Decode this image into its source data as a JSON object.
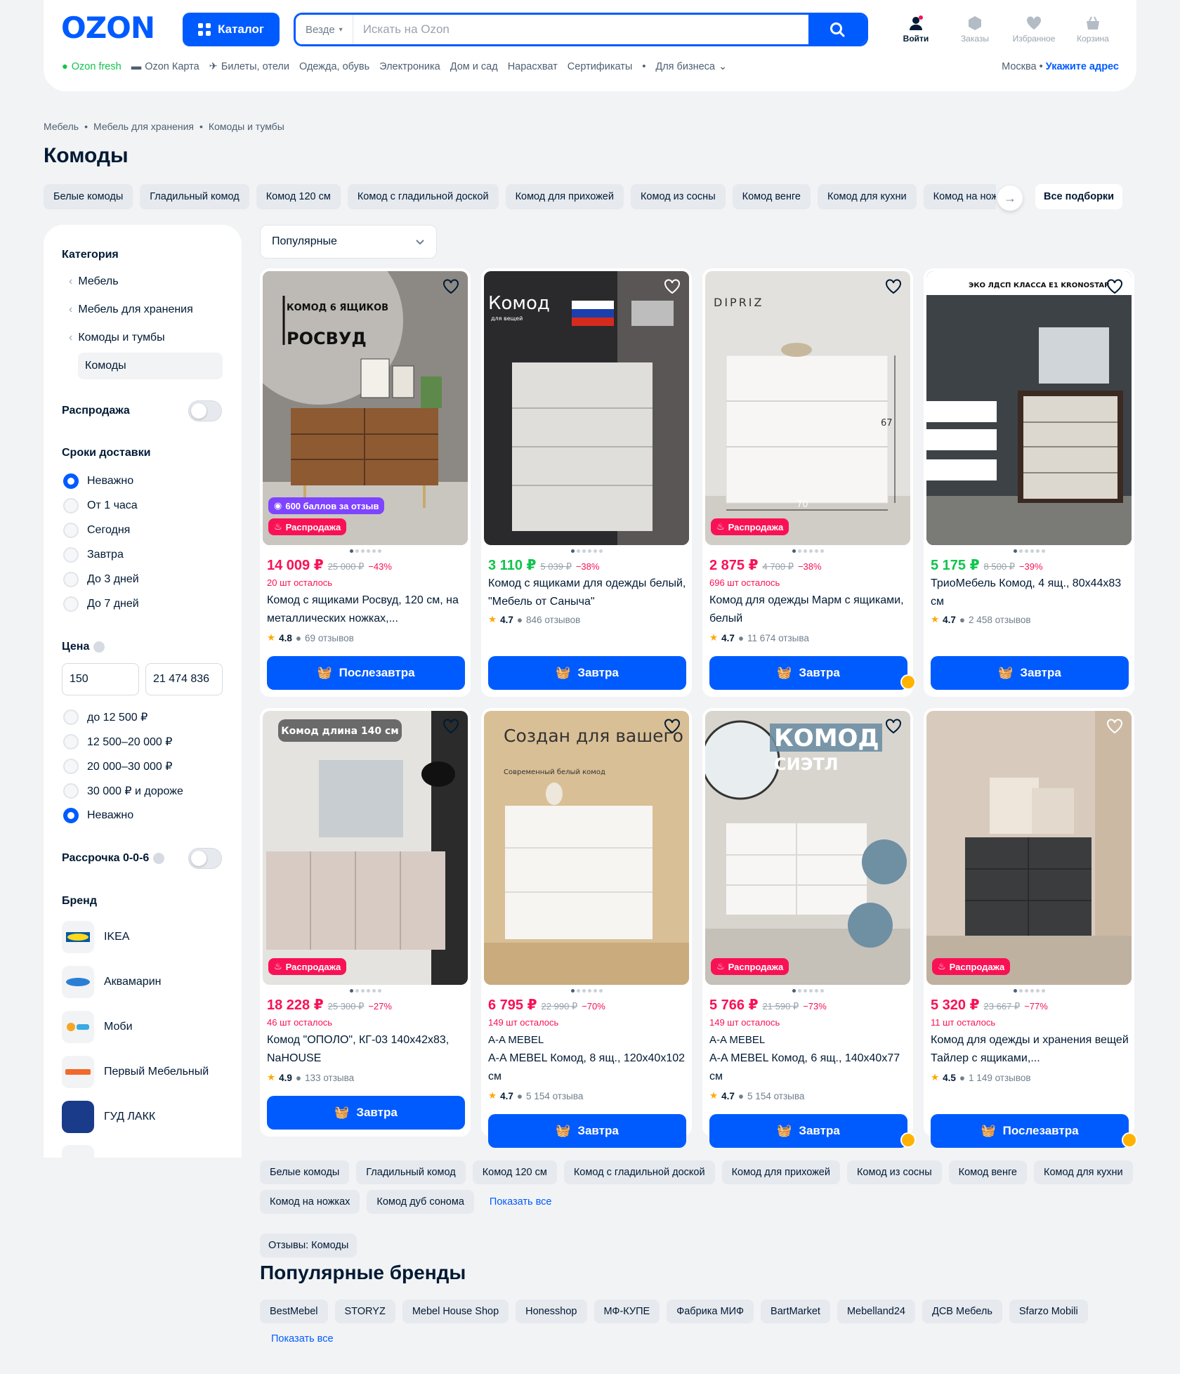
{
  "header": {
    "catalog_label": "Каталог",
    "search_scope": "Везде",
    "search_placeholder": "Искать на Ozon",
    "actions": [
      "Войти",
      "Заказы",
      "Избранное",
      "Корзина"
    ],
    "nav": [
      "Ozon fresh",
      "Ozon Карта",
      "Билеты, отели",
      "Одежда, обувь",
      "Электроника",
      "Дом и сад",
      "Нарасхват",
      "Сертификаты",
      "Для бизнеса"
    ],
    "city": "Москва",
    "address_link": "Укажите адрес"
  },
  "breadcrumb": [
    "Мебель",
    "Мебель для хранения",
    "Комоды и тумбы"
  ],
  "page_title": "Комоды",
  "chips": [
    "Белые комоды",
    "Гладильный комод",
    "Комод 120 см",
    "Комод с гладильной доской",
    "Комод для прихожей",
    "Комод из сосны",
    "Комод венге",
    "Комод для кухни",
    "Комод на ножках"
  ],
  "chips_all": "Все подборки",
  "sidebar": {
    "category_title": "Категория",
    "categories": [
      "Мебель",
      "Мебель для хранения",
      "Комоды и тумбы"
    ],
    "current_category": "Комоды",
    "sale_label": "Распродажа",
    "delivery_title": "Сроки доставки",
    "delivery_options": [
      "Неважно",
      "От 1 часа",
      "Сегодня",
      "Завтра",
      "До 3 дней",
      "До 7 дней"
    ],
    "price_title": "Цена",
    "price_from": "150",
    "price_to": "21 474 836",
    "price_options": [
      "до 12 500 ₽",
      "12 500–20 000 ₽",
      "20 000–30 000 ₽",
      "30 000 ₽ и дороже",
      "Неважно"
    ],
    "installment_label": "Рассрочка 0-0-6",
    "brand_title": "Бренд",
    "brands": [
      "IKEA",
      "Аквамарин",
      "Моби",
      "Первый Мебельный",
      "ГУД ЛАКК"
    ]
  },
  "sort_label": "Популярные",
  "products": [
    {
      "price": "14 009 ₽",
      "old": "25 000 ₽",
      "disc": "−43%",
      "left": "20 шт осталось",
      "title": "Комод с ящиками Росвуд, 120 см, на металлических ножках,...",
      "rating": "4.8",
      "reviews": "69 отзывов",
      "button": "Послезавтра",
      "img_text": "КОМОД 6 ЯЩИКОВ",
      "img_text2": "РОСВУД",
      "bonus": "600 баллов за отзыв",
      "sale": "Распродажа"
    },
    {
      "price": "3 110 ₽",
      "old": "5 039 ₽",
      "disc": "−38%",
      "title": "Комод с ящиками для одежды белый, \"Мебель от Саныча\"",
      "rating": "4.7",
      "reviews": "846 отзывов",
      "button": "Завтра",
      "img_text": "Комод",
      "img_text2": "для вещей"
    },
    {
      "price": "2 875 ₽",
      "old": "4 700 ₽",
      "disc": "−38%",
      "left": "696 шт осталось",
      "title": "Комод для одежды Марм с ящиками, белый",
      "rating": "4.7",
      "reviews": "11 674 отзыва",
      "button": "Завтра",
      "img_text": "DIPRIZ",
      "sale": "Распродажа"
    },
    {
      "price": "5 175 ₽",
      "old": "8 500 ₽",
      "disc": "−39%",
      "title": "ТриоМебель Комод, 4 ящ., 80х44х83 см",
      "rating": "4.7",
      "reviews": "2 458 отзывов",
      "button": "Завтра",
      "img_text": "ЭКО ЛДСП КЛАССА Е1 KRONOSTAR"
    },
    {
      "price": "18 228 ₽",
      "old": "25 300 ₽",
      "disc": "−27%",
      "left": "46 шт осталось",
      "title": "Комод \"ОПОЛО\", КГ-03 140х42х83, NaHOUSE",
      "rating": "4.9",
      "reviews": "133 отзыва",
      "button": "Завтра",
      "img_text": "Комод длина 140 см",
      "sale": "Распродажа"
    },
    {
      "price": "6 795 ₽",
      "old": "22 990 ₽",
      "disc": "−70%",
      "left": "149 шт осталось",
      "brand": "A-A MEBEL",
      "title": "A-A MEBEL Комод, 8 ящ., 120х40х102 см",
      "rating": "4.7",
      "reviews": "5 154 отзыва",
      "button": "Завтра",
      "img_text": "Создан для вашего уюта",
      "img_text2": "Современный белый комод"
    },
    {
      "price": "5 766 ₽",
      "old": "21 590 ₽",
      "disc": "−73%",
      "left": "149 шт осталось",
      "brand": "A-A MEBEL",
      "title": "A-A MEBEL Комод, 6 ящ., 140х40х77 см",
      "rating": "4.7",
      "reviews": "5 154 отзыва",
      "button": "Завтра",
      "img_text": "КОМОД",
      "img_text2": "СИЭТЛ",
      "sale": "Распродажа"
    },
    {
      "price": "5 320 ₽",
      "old": "23 667 ₽",
      "disc": "−77%",
      "left": "11 шт осталось",
      "title": "Комод для одежды и хранения вещей Тайлер с ящиками,...",
      "rating": "4.5",
      "reviews": "1 149 отзывов",
      "button": "Послезавтра",
      "sale": "Распродажа"
    }
  ],
  "bottom_tags": [
    "Белые комоды",
    "Гладильный комод",
    "Комод 120 см",
    "Комод с гладильной доской",
    "Комод для прихожей",
    "Комод из сосны",
    "Комод венге",
    "Комод для кухни",
    "Комод на ножках",
    "Комод дуб сонома"
  ],
  "show_all": "Показать все",
  "reviews_chip": "Отзывы: Комоды",
  "popular_brands_title": "Популярные бренды",
  "popular_brands": [
    "BestMebel",
    "STORYZ",
    "Mebel House Shop",
    "Honesshop",
    "МФ-КУПЕ",
    "Фабрика МИФ",
    "BartMarket",
    "Mebelland24",
    "ДСВ Мебель",
    "Sfarzo Mobili"
  ],
  "colors": {
    "accent": "#005bff",
    "sale": "#f91155",
    "green": "#10c44c"
  }
}
